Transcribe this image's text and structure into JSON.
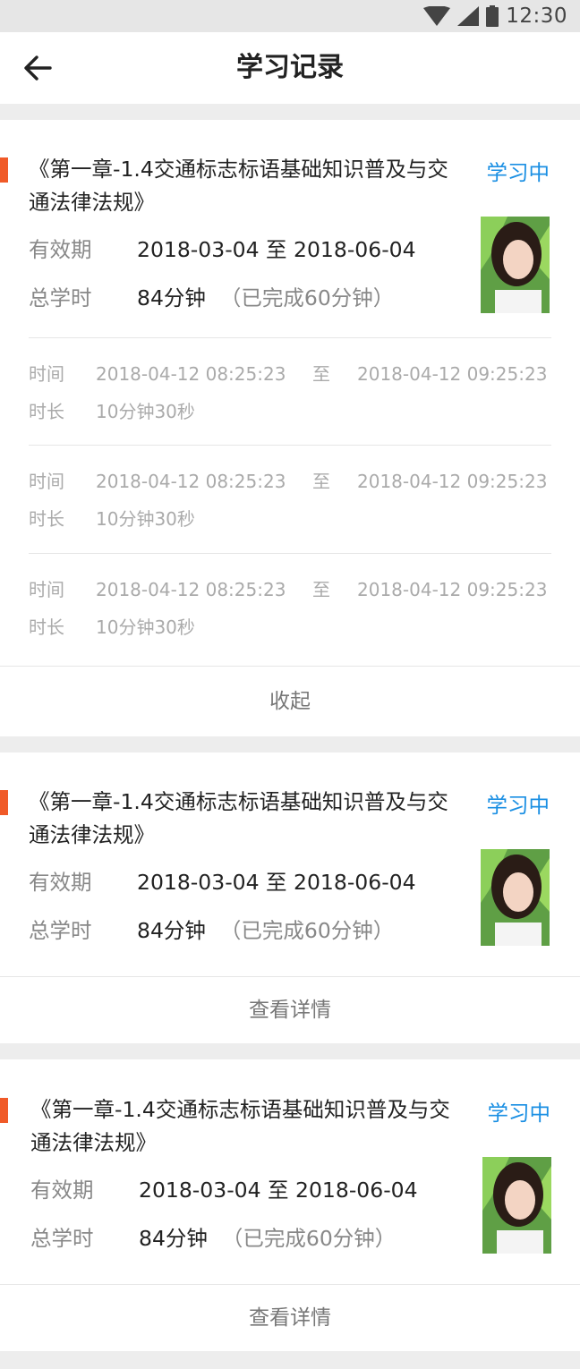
{
  "status_bar": {
    "time": "12:30"
  },
  "header": {
    "title": "学习记录"
  },
  "labels": {
    "validity": "有效期",
    "total_hours": "总学时",
    "time": "时间",
    "to": "至",
    "duration": "时长"
  },
  "cards": [
    {
      "title": "《第一章-1.4交通标志标语基础知识普及与交通法律法规》",
      "status": "学习中",
      "validity": "2018-03-04 至 2018-06-04",
      "total_hours": "84分钟",
      "completed": "（已完成60分钟）",
      "sessions": [
        {
          "start": "2018-04-12 08:25:23",
          "end": "2018-04-12 09:25:23",
          "duration": "10分钟30秒"
        },
        {
          "start": "2018-04-12 08:25:23",
          "end": "2018-04-12 09:25:23",
          "duration": "10分钟30秒"
        },
        {
          "start": "2018-04-12 08:25:23",
          "end": "2018-04-12 09:25:23",
          "duration": "10分钟30秒"
        }
      ],
      "action": "收起"
    },
    {
      "title": "《第一章-1.4交通标志标语基础知识普及与交通法律法规》",
      "status": "学习中",
      "validity": "2018-03-04 至 2018-06-04",
      "total_hours": "84分钟",
      "completed": "（已完成60分钟）",
      "action": "查看详情"
    },
    {
      "title": "《第一章-1.4交通标志标语基础知识普及与交通法律法规》",
      "status": "学习中",
      "validity": "2018-03-04 至 2018-06-04",
      "total_hours": "84分钟",
      "completed": "（已完成60分钟）",
      "action": "查看详情"
    }
  ],
  "icons": {
    "back": "back-arrow-icon",
    "wifi": "wifi-icon",
    "signal": "signal-icon",
    "battery": "battery-icon",
    "avatar": "avatar-photo"
  },
  "colors": {
    "accent": "#f05a28",
    "status": "#1a8fe3",
    "page_background": "#ededed"
  }
}
